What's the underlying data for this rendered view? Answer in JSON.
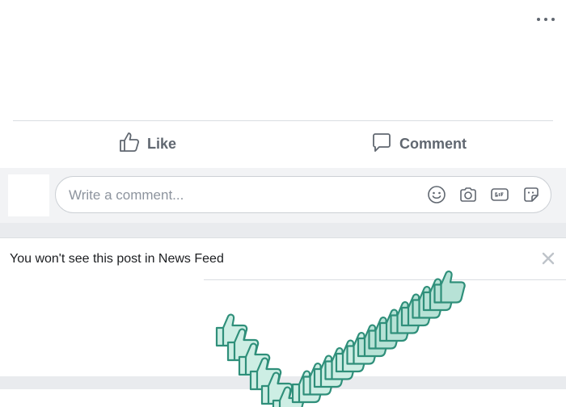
{
  "post": {
    "more_icon": "more-horizontal-icon",
    "like_label": "Like",
    "comment_label": "Comment",
    "like_icon": "thumbs-up-outline-icon",
    "comment_icon": "speech-bubble-icon"
  },
  "composer": {
    "placeholder": "Write a comment...",
    "tools": [
      "emoji-icon",
      "camera-icon",
      "gif-icon",
      "sticker-icon"
    ]
  },
  "hidden_notice": {
    "message": "You won't see this post in News Feed",
    "close_icon": "close-icon",
    "graphic": "thumbs-up-checkmark-animation"
  },
  "colors": {
    "text_secondary": "#606770",
    "placeholder": "#8d949e",
    "graphic_dark": "#2f8f7a",
    "graphic_light": "#b7e2d6"
  }
}
